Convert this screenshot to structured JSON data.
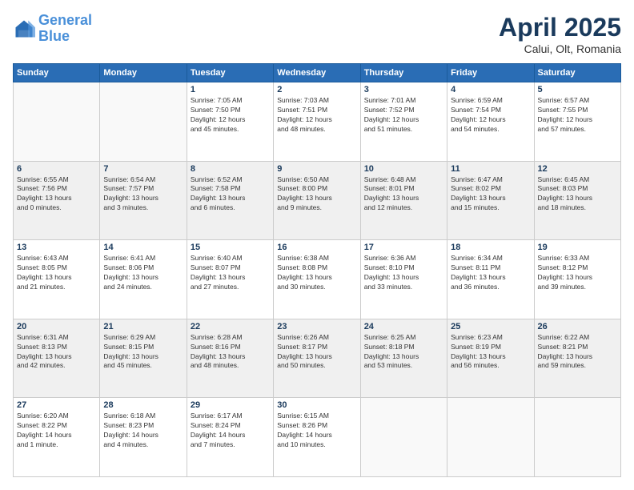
{
  "header": {
    "logo_line1": "General",
    "logo_line2": "Blue",
    "month_title": "April 2025",
    "subtitle": "Calui, Olt, Romania"
  },
  "days_of_week": [
    "Sunday",
    "Monday",
    "Tuesday",
    "Wednesday",
    "Thursday",
    "Friday",
    "Saturday"
  ],
  "weeks": [
    [
      {
        "num": "",
        "detail": ""
      },
      {
        "num": "",
        "detail": ""
      },
      {
        "num": "1",
        "detail": "Sunrise: 7:05 AM\nSunset: 7:50 PM\nDaylight: 12 hours\nand 45 minutes."
      },
      {
        "num": "2",
        "detail": "Sunrise: 7:03 AM\nSunset: 7:51 PM\nDaylight: 12 hours\nand 48 minutes."
      },
      {
        "num": "3",
        "detail": "Sunrise: 7:01 AM\nSunset: 7:52 PM\nDaylight: 12 hours\nand 51 minutes."
      },
      {
        "num": "4",
        "detail": "Sunrise: 6:59 AM\nSunset: 7:54 PM\nDaylight: 12 hours\nand 54 minutes."
      },
      {
        "num": "5",
        "detail": "Sunrise: 6:57 AM\nSunset: 7:55 PM\nDaylight: 12 hours\nand 57 minutes."
      }
    ],
    [
      {
        "num": "6",
        "detail": "Sunrise: 6:55 AM\nSunset: 7:56 PM\nDaylight: 13 hours\nand 0 minutes."
      },
      {
        "num": "7",
        "detail": "Sunrise: 6:54 AM\nSunset: 7:57 PM\nDaylight: 13 hours\nand 3 minutes."
      },
      {
        "num": "8",
        "detail": "Sunrise: 6:52 AM\nSunset: 7:58 PM\nDaylight: 13 hours\nand 6 minutes."
      },
      {
        "num": "9",
        "detail": "Sunrise: 6:50 AM\nSunset: 8:00 PM\nDaylight: 13 hours\nand 9 minutes."
      },
      {
        "num": "10",
        "detail": "Sunrise: 6:48 AM\nSunset: 8:01 PM\nDaylight: 13 hours\nand 12 minutes."
      },
      {
        "num": "11",
        "detail": "Sunrise: 6:47 AM\nSunset: 8:02 PM\nDaylight: 13 hours\nand 15 minutes."
      },
      {
        "num": "12",
        "detail": "Sunrise: 6:45 AM\nSunset: 8:03 PM\nDaylight: 13 hours\nand 18 minutes."
      }
    ],
    [
      {
        "num": "13",
        "detail": "Sunrise: 6:43 AM\nSunset: 8:05 PM\nDaylight: 13 hours\nand 21 minutes."
      },
      {
        "num": "14",
        "detail": "Sunrise: 6:41 AM\nSunset: 8:06 PM\nDaylight: 13 hours\nand 24 minutes."
      },
      {
        "num": "15",
        "detail": "Sunrise: 6:40 AM\nSunset: 8:07 PM\nDaylight: 13 hours\nand 27 minutes."
      },
      {
        "num": "16",
        "detail": "Sunrise: 6:38 AM\nSunset: 8:08 PM\nDaylight: 13 hours\nand 30 minutes."
      },
      {
        "num": "17",
        "detail": "Sunrise: 6:36 AM\nSunset: 8:10 PM\nDaylight: 13 hours\nand 33 minutes."
      },
      {
        "num": "18",
        "detail": "Sunrise: 6:34 AM\nSunset: 8:11 PM\nDaylight: 13 hours\nand 36 minutes."
      },
      {
        "num": "19",
        "detail": "Sunrise: 6:33 AM\nSunset: 8:12 PM\nDaylight: 13 hours\nand 39 minutes."
      }
    ],
    [
      {
        "num": "20",
        "detail": "Sunrise: 6:31 AM\nSunset: 8:13 PM\nDaylight: 13 hours\nand 42 minutes."
      },
      {
        "num": "21",
        "detail": "Sunrise: 6:29 AM\nSunset: 8:15 PM\nDaylight: 13 hours\nand 45 minutes."
      },
      {
        "num": "22",
        "detail": "Sunrise: 6:28 AM\nSunset: 8:16 PM\nDaylight: 13 hours\nand 48 minutes."
      },
      {
        "num": "23",
        "detail": "Sunrise: 6:26 AM\nSunset: 8:17 PM\nDaylight: 13 hours\nand 50 minutes."
      },
      {
        "num": "24",
        "detail": "Sunrise: 6:25 AM\nSunset: 8:18 PM\nDaylight: 13 hours\nand 53 minutes."
      },
      {
        "num": "25",
        "detail": "Sunrise: 6:23 AM\nSunset: 8:19 PM\nDaylight: 13 hours\nand 56 minutes."
      },
      {
        "num": "26",
        "detail": "Sunrise: 6:22 AM\nSunset: 8:21 PM\nDaylight: 13 hours\nand 59 minutes."
      }
    ],
    [
      {
        "num": "27",
        "detail": "Sunrise: 6:20 AM\nSunset: 8:22 PM\nDaylight: 14 hours\nand 1 minute."
      },
      {
        "num": "28",
        "detail": "Sunrise: 6:18 AM\nSunset: 8:23 PM\nDaylight: 14 hours\nand 4 minutes."
      },
      {
        "num": "29",
        "detail": "Sunrise: 6:17 AM\nSunset: 8:24 PM\nDaylight: 14 hours\nand 7 minutes."
      },
      {
        "num": "30",
        "detail": "Sunrise: 6:15 AM\nSunset: 8:26 PM\nDaylight: 14 hours\nand 10 minutes."
      },
      {
        "num": "",
        "detail": ""
      },
      {
        "num": "",
        "detail": ""
      },
      {
        "num": "",
        "detail": ""
      }
    ]
  ]
}
